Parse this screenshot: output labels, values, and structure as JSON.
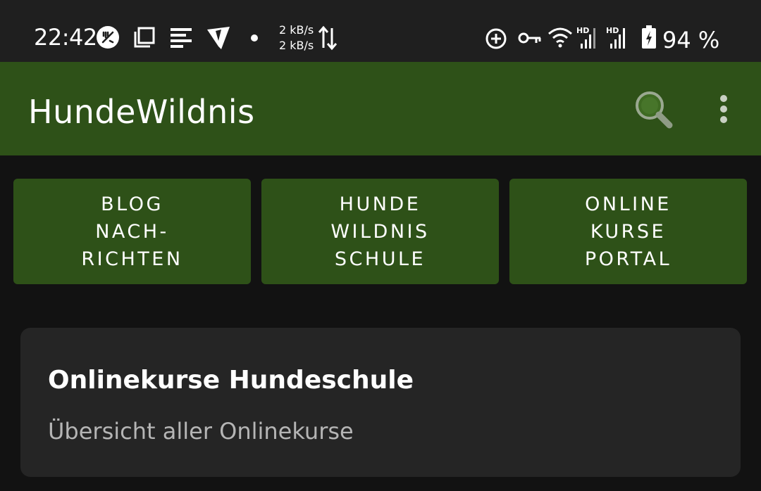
{
  "status_bar": {
    "time": "22:42",
    "net_up": "2 kB/s",
    "net_down": "2 kB/s",
    "battery": "94 %",
    "icons": [
      "fork-knife-icon",
      "copy-icon",
      "notes-icon",
      "vpn-shield-icon",
      "dot-icon",
      "data-arrows-icon",
      "add-circle-icon",
      "key-icon",
      "wifi-icon",
      "signal-hd-icon",
      "signal-hd-icon",
      "battery-charging-icon"
    ]
  },
  "app_bar": {
    "title": "HundeWildnis",
    "search_icon": "search-icon",
    "menu_icon": "more-vert-icon"
  },
  "nav_buttons": [
    {
      "label": "BLOG\nNACH-\nRICHTEN"
    },
    {
      "label": "HUNDE\nWILDNIS\nSCHULE"
    },
    {
      "label": "ONLINE\nKURSE\nPORTAL"
    }
  ],
  "card": {
    "title": "Onlinekurse Hundeschule",
    "subtitle": "Übersicht aller Onlinekurse"
  },
  "colors": {
    "accent": "#2e5118",
    "background": "#121212",
    "card": "#252525",
    "status_bar": "#1f1f1f"
  }
}
